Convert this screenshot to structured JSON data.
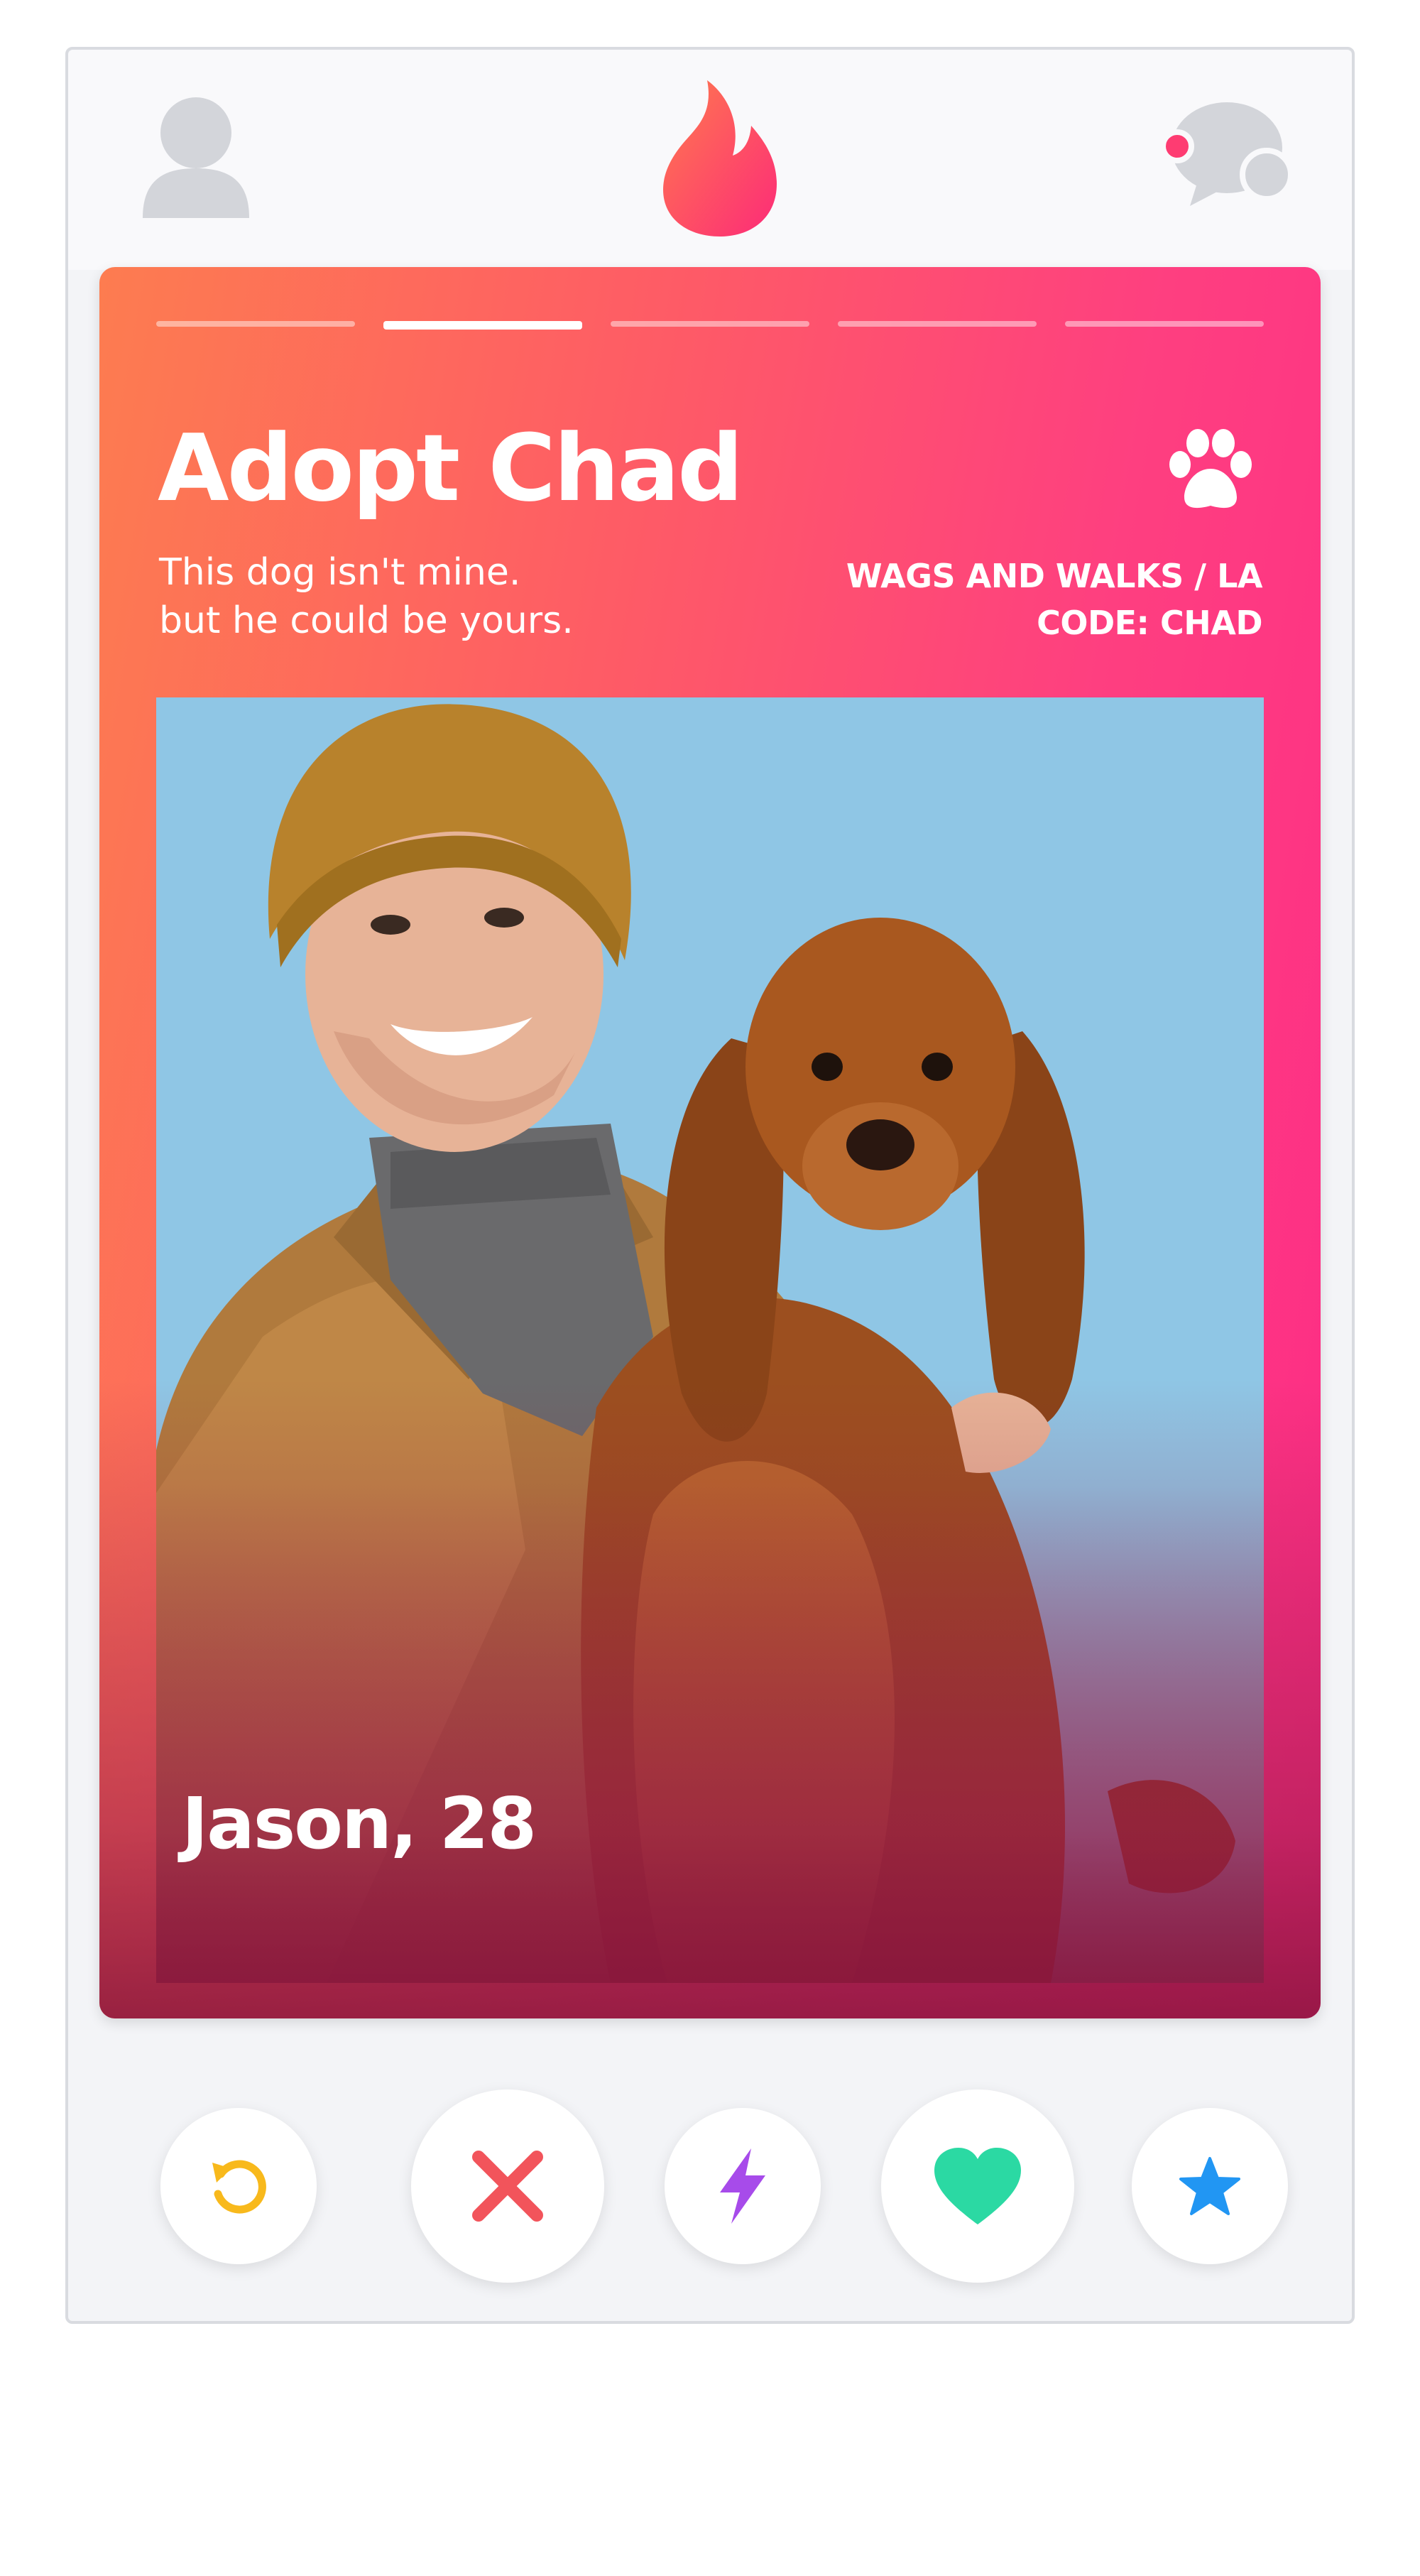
{
  "topbar": {
    "left_icon": "profile-icon",
    "center_icon": "flame-logo-icon",
    "right_icon": "chat-icon",
    "brand_color": "#fe4f6c",
    "notification_color": "#fe3c72"
  },
  "card": {
    "progress": {
      "total_segments": 5,
      "active_segment": 2
    },
    "title": "Adopt Chad",
    "subtitle": "This dog isn't mine.\nbut he could be yours.",
    "badge_icon": "paw-icon",
    "organization": "WAGS AND WALKS / LA",
    "code": "CODE: CHAD",
    "name_age": "Jason, 28",
    "gradient_colors": [
      "#fd7c50",
      "#fe3f80"
    ]
  },
  "actions": [
    {
      "name": "rewind",
      "icon": "rewind-icon",
      "color": "#f8b91c"
    },
    {
      "name": "nope",
      "icon": "close-x-icon",
      "color": "#f2545b"
    },
    {
      "name": "boost",
      "icon": "lightning-bolt-icon",
      "color": "#a74bea"
    },
    {
      "name": "like",
      "icon": "heart-icon",
      "color": "#2bd9a3"
    },
    {
      "name": "super-like",
      "icon": "star-icon",
      "color": "#2196f3"
    }
  ]
}
